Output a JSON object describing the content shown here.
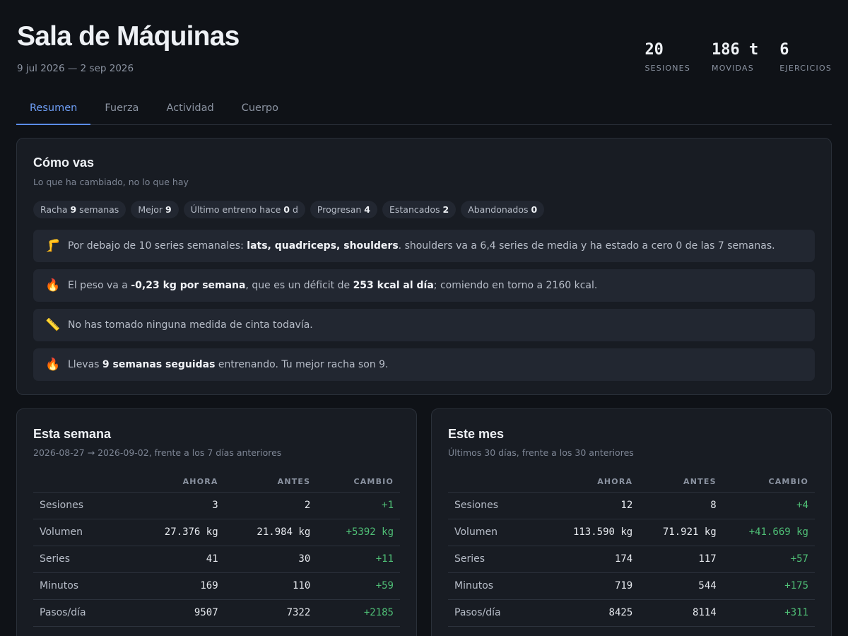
{
  "header": {
    "title": "Sala de Máquinas",
    "date_range": "9 jul 2026 — 2 sep 2026",
    "stats": [
      {
        "value": "20",
        "label": "SESIONES"
      },
      {
        "value": "186 t",
        "label": "MOVIDAS"
      },
      {
        "value": "6",
        "label": "EJERCICIOS"
      }
    ]
  },
  "tabs": [
    {
      "label": "Resumen",
      "active": true
    },
    {
      "label": "Fuerza",
      "active": false
    },
    {
      "label": "Actividad",
      "active": false
    },
    {
      "label": "Cuerpo",
      "active": false
    }
  ],
  "summary": {
    "title": "Cómo vas",
    "subtitle": "Lo que ha cambiado, no lo que hay",
    "chips": [
      {
        "prefix": "Racha ",
        "value": "9",
        "suffix": " semanas"
      },
      {
        "prefix": "Mejor ",
        "value": "9",
        "suffix": ""
      },
      {
        "prefix": "Último entreno hace ",
        "value": "0",
        "suffix": " d"
      },
      {
        "prefix": "Progresan ",
        "value": "4",
        "suffix": ""
      },
      {
        "prefix": "Estancados ",
        "value": "2",
        "suffix": ""
      },
      {
        "prefix": "Abandonados ",
        "value": "0",
        "suffix": ""
      }
    ],
    "notes": [
      {
        "icon": "leg-icon",
        "glyph": "🦵",
        "parts": [
          {
            "t": "Por debajo de 10 series semanales: "
          },
          {
            "t": "lats, quadriceps, shoulders",
            "b": true
          },
          {
            "t": ". shoulders va a 6,4 series de media y ha estado a cero 0 de las 7 semanas."
          }
        ]
      },
      {
        "icon": "fire-icon",
        "glyph": "🔥",
        "parts": [
          {
            "t": "El peso va a "
          },
          {
            "t": "-0,23 kg por semana",
            "b": true
          },
          {
            "t": ", que es un déficit de "
          },
          {
            "t": "253 kcal al día",
            "b": true
          },
          {
            "t": "; comiendo en torno a 2160 kcal."
          }
        ]
      },
      {
        "icon": "ruler-icon",
        "glyph": "📏",
        "parts": [
          {
            "t": "No has tomado ninguna medida de cinta todavía."
          }
        ]
      },
      {
        "icon": "fire-icon",
        "glyph": "🔥",
        "parts": [
          {
            "t": "Llevas "
          },
          {
            "t": "9 semanas seguidas",
            "b": true
          },
          {
            "t": " entrenando. Tu mejor racha son 9."
          }
        ]
      }
    ]
  },
  "week": {
    "title": "Esta semana",
    "subtitle": "2026-08-27 → 2026-09-02, frente a los 7 días anteriores",
    "columns": [
      "",
      "AHORA",
      "ANTES",
      "CAMBIO"
    ],
    "rows": [
      [
        "Sesiones",
        "3",
        "2",
        "+1"
      ],
      [
        "Volumen",
        "27.376 kg",
        "21.984 kg",
        "+5392 kg"
      ],
      [
        "Series",
        "41",
        "30",
        "+11"
      ],
      [
        "Minutos",
        "169",
        "110",
        "+59"
      ],
      [
        "Pasos/día",
        "9507",
        "7322",
        "+2185"
      ]
    ]
  },
  "month": {
    "title": "Este mes",
    "subtitle": "Últimos 30 días, frente a los 30 anteriores",
    "columns": [
      "",
      "AHORA",
      "ANTES",
      "CAMBIO"
    ],
    "rows": [
      [
        "Sesiones",
        "12",
        "8",
        "+4"
      ],
      [
        "Volumen",
        "113.590 kg",
        "71.921 kg",
        "+41.669 kg"
      ],
      [
        "Series",
        "174",
        "117",
        "+57"
      ],
      [
        "Minutos",
        "719",
        "544",
        "+175"
      ],
      [
        "Pasos/día",
        "8425",
        "8114",
        "+311"
      ]
    ]
  },
  "colors": {
    "accent": "#5b8def",
    "positive": "#4fbf76",
    "background": "#0f1217",
    "card": "#181c23"
  }
}
